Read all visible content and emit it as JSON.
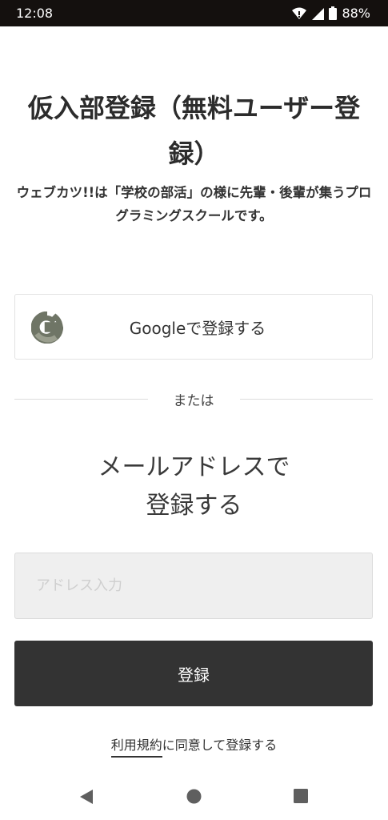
{
  "status_bar": {
    "time": "12:08",
    "battery": "88%",
    "icons": [
      "wifi-icon",
      "signal-icon",
      "battery-icon"
    ]
  },
  "header": {
    "title": "仮入部登録（無料ユーザー登録）",
    "subtitle": "ウェブカツ!!は「学校の部活」の様に先輩・後輩が集うプログラミングスクールです。"
  },
  "google_button": {
    "label": "Googleで登録する",
    "icon": "google-g-icon"
  },
  "divider": {
    "label": "または"
  },
  "email_section": {
    "heading_line1": "メールアドレスで",
    "heading_line2": "登録する",
    "placeholder": "アドレス入力",
    "value": "",
    "submit_label": "登録"
  },
  "terms": {
    "link_label": "利用規約",
    "text": "に同意して登録する"
  },
  "nav": {
    "icons": [
      "back-icon",
      "home-icon",
      "recent-apps-icon"
    ]
  },
  "colors": {
    "status_bar_bg": "#14100e",
    "primary_button_bg": "#333333",
    "input_bg": "#efefef",
    "text": "#333333"
  }
}
